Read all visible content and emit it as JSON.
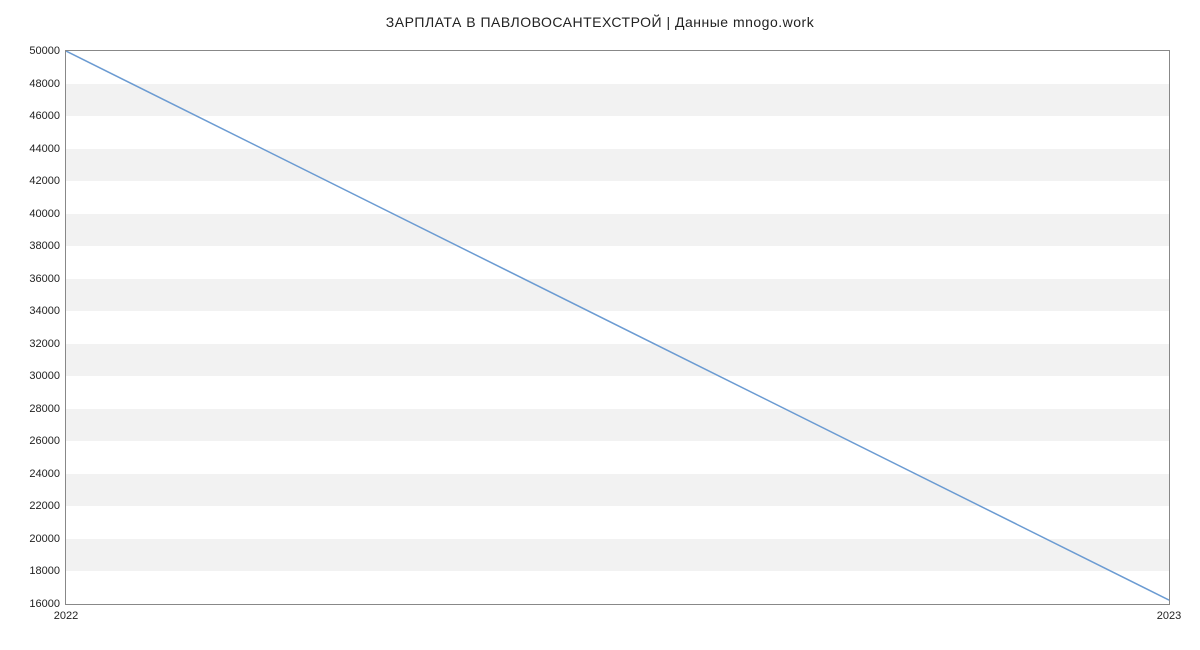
{
  "chart_data": {
    "type": "line",
    "title": "ЗАРПЛАТА В ПАВЛОВОСАНТЕХСТРОЙ | Данные mnogo.work",
    "x": [
      "2022",
      "2023"
    ],
    "values": [
      50000,
      16242
    ],
    "xlabel": "",
    "ylabel": "",
    "ylim": [
      16000,
      50000
    ],
    "y_ticks": [
      16000,
      18000,
      20000,
      22000,
      24000,
      26000,
      28000,
      30000,
      32000,
      34000,
      36000,
      38000,
      40000,
      42000,
      44000,
      46000,
      48000,
      50000
    ],
    "x_ticks": [
      "2022",
      "2023"
    ],
    "line_color": "#6b9bd2",
    "stripe_color": "#f2f2f2"
  }
}
